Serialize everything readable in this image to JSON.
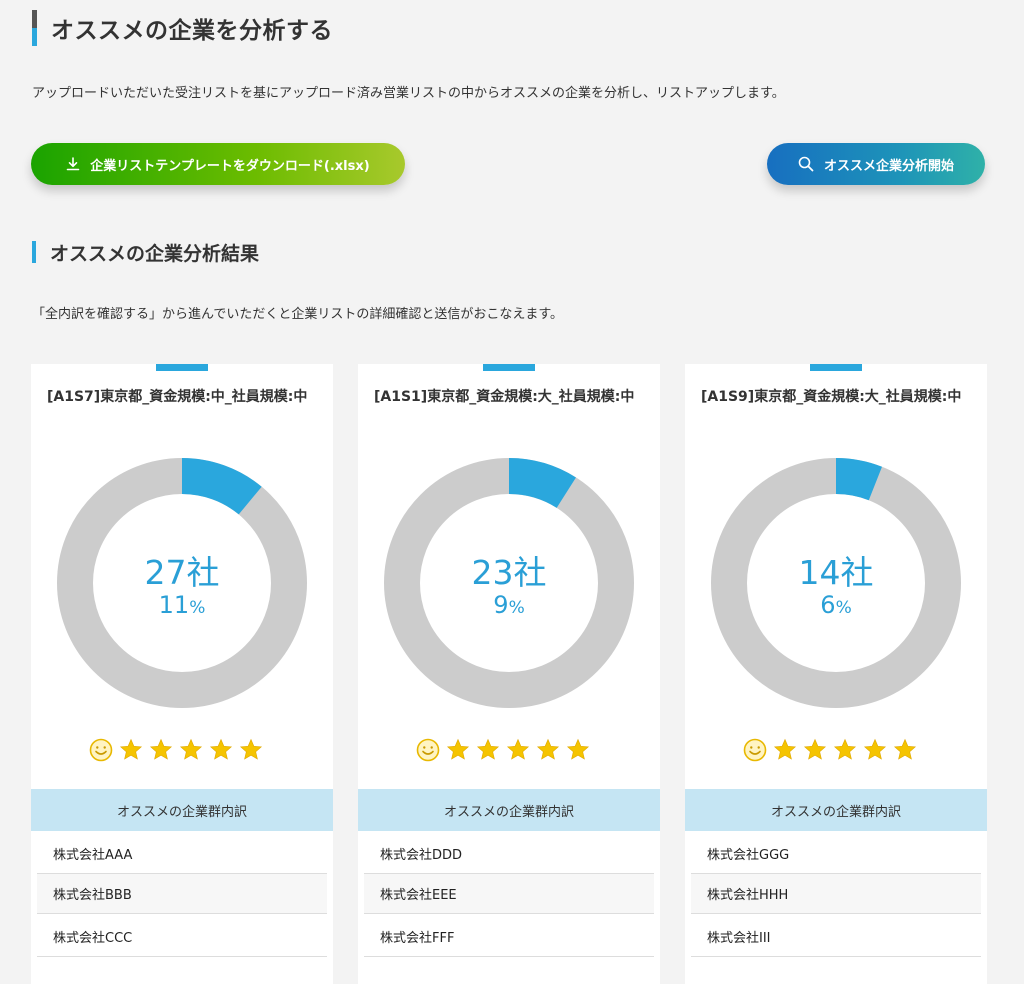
{
  "header": {
    "title": "オススメの企業を分析する",
    "description": "アップロードいただいた受注リストを基にアップロード済み営業リストの中からオススメの企業を分析し、リストアップします。"
  },
  "actions": {
    "download_label": "企業リストテンプレートをダウンロード(.xlsx)",
    "analyze_label": "オススメ企業分析開始"
  },
  "results": {
    "title": "オススメの企業分析結果",
    "description": "「全内訳を確認する」から進んでいただくと企業リストの詳細確認と送信がおこなえます。",
    "list_header": "オススメの企業群内訳"
  },
  "colors": {
    "accent": "#2aa7dd",
    "ring": "#cccccc",
    "star": "#f5c400",
    "list_header_bg": "#c5e5f3"
  },
  "cards": [
    {
      "title": "[A1S7]東京都_資金規模:中_社員規模:中",
      "count": "27社",
      "percent_value": "11",
      "percent_unit": "%",
      "percent": 11,
      "rating": 5,
      "companies": [
        "株式会社AAA",
        "株式会社BBB",
        "株式会社CCC"
      ]
    },
    {
      "title": "[A1S1]東京都_資金規模:大_社員規模:中",
      "count": "23社",
      "percent_value": "9",
      "percent_unit": "%",
      "percent": 9,
      "rating": 5,
      "companies": [
        "株式会社DDD",
        "株式会社EEE",
        "株式会社FFF"
      ]
    },
    {
      "title": "[A1S9]東京都_資金規模:大_社員規模:中",
      "count": "14社",
      "percent_value": "6",
      "percent_unit": "%",
      "percent": 6,
      "rating": 5,
      "companies": [
        "株式会社GGG",
        "株式会社HHH",
        "株式会社III"
      ]
    }
  ]
}
